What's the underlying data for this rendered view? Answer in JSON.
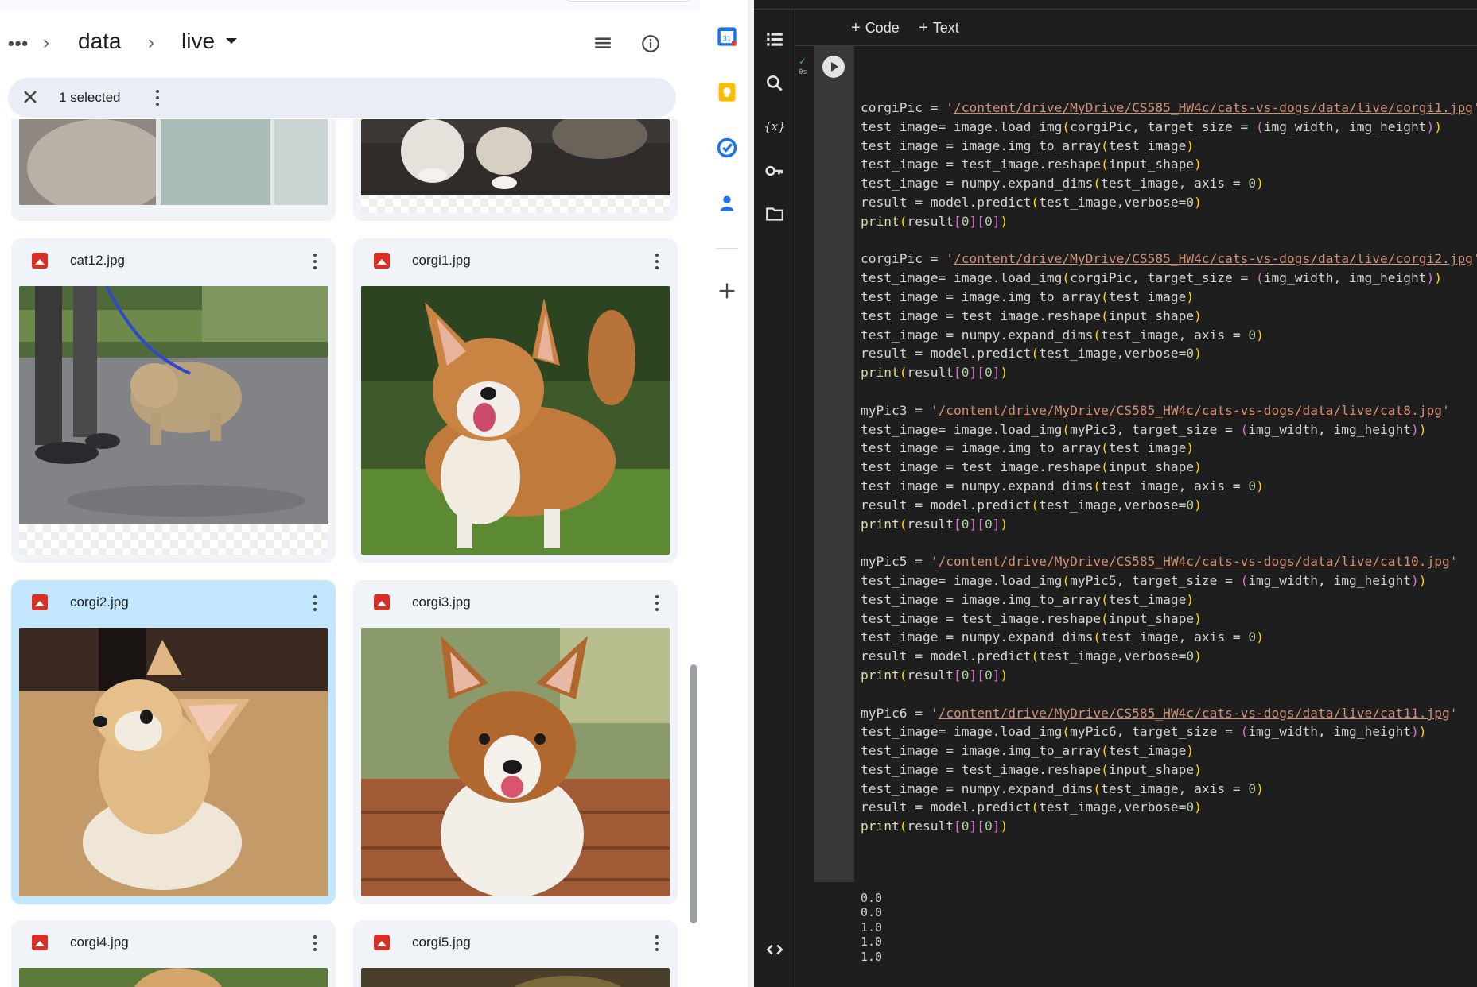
{
  "drive": {
    "breadcrumb": {
      "more_label": "•••",
      "items": [
        "data",
        "live"
      ]
    },
    "selection": {
      "label": "1 selected"
    },
    "files": [
      {
        "name": "",
        "kind": "cat-photo"
      },
      {
        "name": "",
        "kind": "cat-paws"
      },
      {
        "name": "cat12.jpg"
      },
      {
        "name": "corgi1.jpg"
      },
      {
        "name": "corgi2.jpg",
        "selected": true
      },
      {
        "name": "corgi3.jpg"
      },
      {
        "name": "corgi4.jpg"
      },
      {
        "name": "corgi5.jpg"
      }
    ],
    "colors": {
      "selected_card": "#c2e7ff",
      "card": "#f0f4f9",
      "file_icon": "#d93025"
    }
  },
  "sidepanel": {
    "icons": [
      "calendar-icon",
      "keep-icon",
      "tasks-icon",
      "contacts-icon",
      "add-icon"
    ],
    "calendar_day": "31"
  },
  "colab": {
    "toolbar": {
      "code_label": "Code",
      "text_label": "Text",
      "plus": "+"
    },
    "cell": {
      "status_check": "✓",
      "exec_time": "0s",
      "blocks": [
        {
          "var": "corgiPic",
          "path": "/content/drive/MyDrive/CS585_HW4c/cats-vs-dogs/data/live/corgi1.jpg"
        },
        {
          "var": "corgiPic",
          "path": "/content/drive/MyDrive/CS585_HW4c/cats-vs-dogs/data/live/corgi2.jpg"
        },
        {
          "var": "myPic3",
          "path": "/content/drive/MyDrive/CS585_HW4c/cats-vs-dogs/data/live/cat8.jpg"
        },
        {
          "var": "myPic5",
          "path": "/content/drive/MyDrive/CS585_HW4c/cats-vs-dogs/data/live/cat10.jpg"
        },
        {
          "var": "myPic6",
          "path": "/content/drive/MyDrive/CS585_HW4c/cats-vs-dogs/data/live/cat11.jpg"
        }
      ],
      "output": [
        "0.0",
        "0.0",
        "1.0",
        "1.0",
        "1.0"
      ]
    },
    "rail_icons": [
      "table-of-contents-icon",
      "search-icon",
      "variables-icon",
      "secrets-key-icon",
      "files-folder-icon",
      "code-snippets-icon"
    ]
  }
}
